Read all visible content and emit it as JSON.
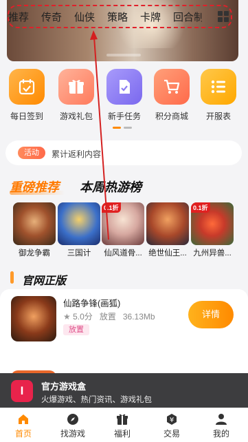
{
  "category_tabs": [
    "推荐",
    "传奇",
    "仙侠",
    "策略",
    "卡牌",
    "回合制"
  ],
  "quick_entries": [
    {
      "label": "每日签到",
      "color": "#ff9a1f",
      "icon": "calendar-check-icon"
    },
    {
      "label": "游戏礼包",
      "color": "#ff8e72",
      "icon": "gift-icon"
    },
    {
      "label": "新手任务",
      "color": "#8d7cf2",
      "icon": "task-doc-icon"
    },
    {
      "label": "积分商城",
      "color": "#ff7a5c",
      "icon": "cart-icon"
    },
    {
      "label": "开服表",
      "color": "#ffb41e",
      "icon": "list-icon"
    }
  ],
  "activity": {
    "badge": "活动",
    "text": "累计返利内容"
  },
  "rank_tabs": {
    "active": "重磅推荐",
    "inactive": "本周热游榜"
  },
  "rank_games": [
    "御龙争霸",
    "三国计",
    "仙风道骨...",
    "绝世仙王...",
    "九州异兽..."
  ],
  "rank_badge": "0.1折",
  "official": {
    "section_title": "官网正版",
    "game": {
      "name": "仙路争锋(画狐)",
      "rating": "5.0分",
      "category": "放置",
      "size": "36.13Mb",
      "tag": "放置",
      "button": "详情"
    }
  },
  "official_box": {
    "logo": "I",
    "title": "官方游戏盒",
    "subtitle": "火爆游戏、热门资讯、游戏礼包"
  },
  "nav": [
    {
      "label": "首页",
      "active": true,
      "icon": "home-icon"
    },
    {
      "label": "找游戏",
      "active": false,
      "icon": "compass-icon"
    },
    {
      "label": "福利",
      "active": false,
      "icon": "gift-icon"
    },
    {
      "label": "交易",
      "active": false,
      "icon": "trade-icon"
    },
    {
      "label": "我的",
      "active": false,
      "icon": "user-icon"
    }
  ],
  "accent_color": "#ff8a00"
}
